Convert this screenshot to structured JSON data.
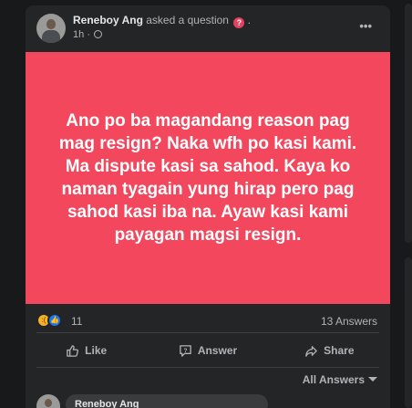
{
  "post": {
    "author": "Reneboy Ang",
    "action_text": "asked a question",
    "time": "1h",
    "meta_sep": "·",
    "privacy_icon": "globe-icon",
    "more_label": "•••",
    "question_text": "Ano po ba magandang reason pag mag resign? Naka wfh po kasi kami. Ma dispute kasi sa sahod. Kaya ko naman tyagain yung hirap pero pag sahod kasi iba na. Ayaw kasi kami payagan magsi resign.",
    "question_bg": "#f2475d"
  },
  "stats": {
    "reaction_icons": [
      "sad-reaction-icon",
      "like-reaction-icon"
    ],
    "reaction_count": "11",
    "answers_count": "13 Answers"
  },
  "actions": {
    "like": "Like",
    "answer": "Answer",
    "share": "Share"
  },
  "sort": {
    "label": "All Answers"
  },
  "comment": {
    "author": "Reneboy Ang"
  }
}
